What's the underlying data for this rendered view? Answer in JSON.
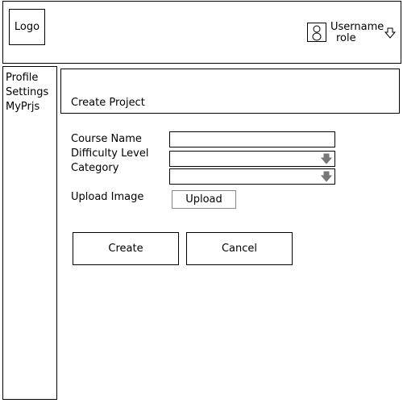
{
  "header": {
    "logo": "Logo",
    "username": "Username",
    "role": "role",
    "avatar_icon": "person-icon",
    "dropdown_icon": "arrow-down-icon"
  },
  "sidebar": {
    "items": [
      {
        "label": "Profile"
      },
      {
        "label": "Settings"
      },
      {
        "label": "MyPrjs"
      }
    ]
  },
  "main": {
    "title": "Create Project",
    "form": {
      "course_name_label": "Course Name",
      "course_name_value": "",
      "difficulty_label": "Difficulty Level",
      "difficulty_value": "",
      "category_label": "Category",
      "category_value": "",
      "upload_label": "Upload Image",
      "upload_button": "Upload"
    },
    "create_button": "Create",
    "cancel_button": "Cancel"
  }
}
